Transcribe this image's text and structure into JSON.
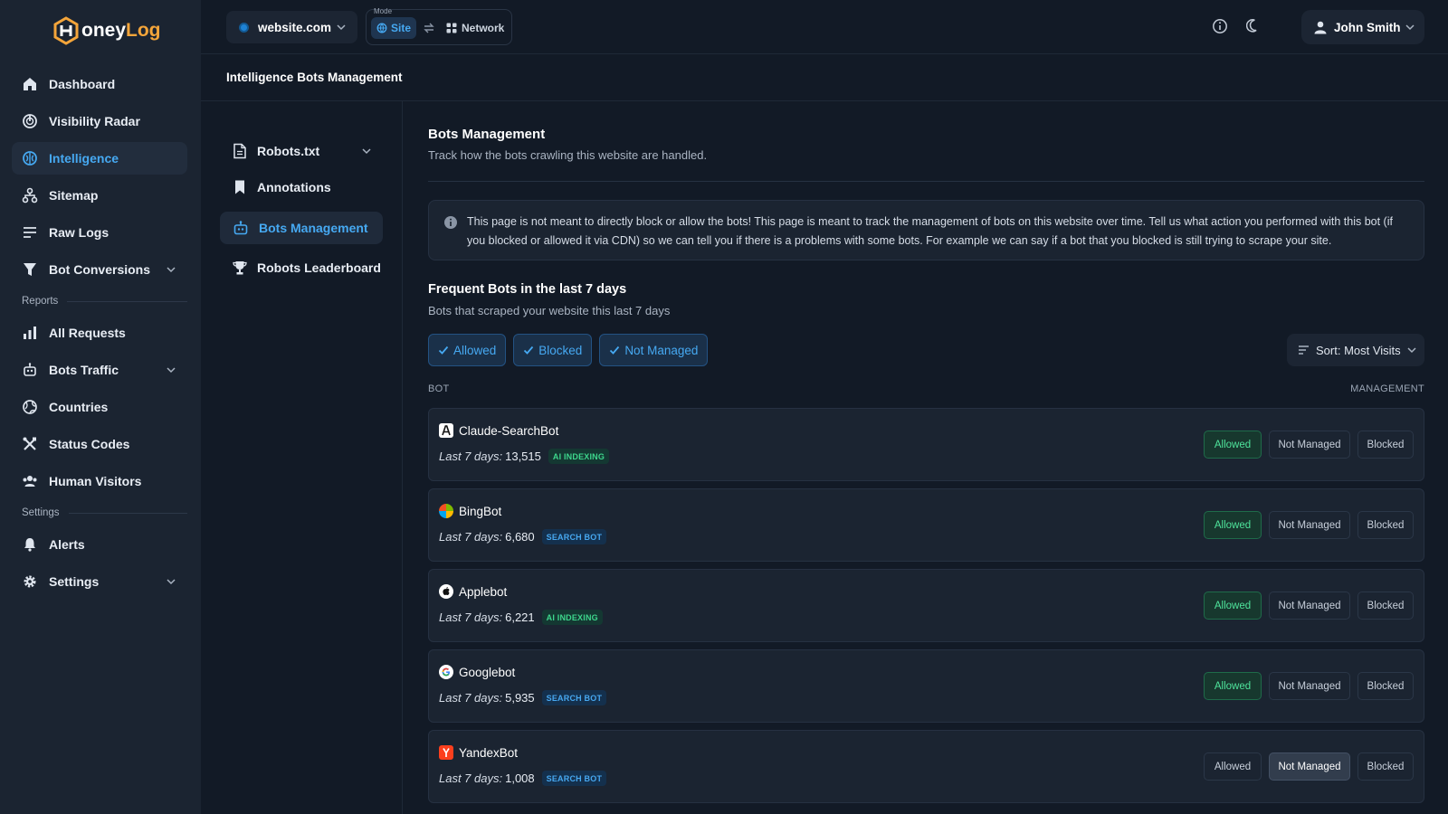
{
  "app": {
    "logo_pre": "H",
    "logo_mid": "oney",
    "logo_post": "Log"
  },
  "sidebar": {
    "items": [
      {
        "label": "Dashboard",
        "icon": "home-icon"
      },
      {
        "label": "Visibility Radar",
        "icon": "radar-icon"
      },
      {
        "label": "Intelligence",
        "icon": "brain-icon",
        "active": true
      },
      {
        "label": "Sitemap",
        "icon": "sitemap-icon"
      },
      {
        "label": "Raw Logs",
        "icon": "list-icon"
      },
      {
        "label": "Bot Conversions",
        "icon": "funnel-icon",
        "expandable": true
      }
    ],
    "reports_label": "Reports",
    "report_items": [
      {
        "label": "All Requests",
        "icon": "bar-chart-icon"
      },
      {
        "label": "Bots Traffic",
        "icon": "robot-icon",
        "expandable": true
      },
      {
        "label": "Countries",
        "icon": "globe-icon"
      },
      {
        "label": "Status Codes",
        "icon": "tools-icon"
      },
      {
        "label": "Human Visitors",
        "icon": "users-icon"
      }
    ],
    "settings_label": "Settings",
    "settings_items": [
      {
        "label": "Alerts",
        "icon": "bell-icon"
      },
      {
        "label": "Settings",
        "icon": "gear-icon",
        "expandable": true
      }
    ]
  },
  "topbar": {
    "site": "website.com",
    "mode_label": "Mode",
    "mode_site": "Site",
    "mode_network": "Network",
    "user": "John Smith"
  },
  "breadcrumb": {
    "part1": "Intelligence",
    "part2": "Bots Management"
  },
  "subnav": {
    "items": [
      {
        "label": "Robots.txt",
        "icon": "file-icon",
        "expandable": true
      },
      {
        "label": "Annotations",
        "icon": "bookmark-icon"
      },
      {
        "label": "Bots Management",
        "icon": "robot-icon",
        "active": true
      },
      {
        "label": "Robots Leaderboard",
        "icon": "trophy-icon"
      }
    ]
  },
  "main": {
    "title": "Bots Management",
    "subtitle": "Track how the bots crawling this website are handled.",
    "info": "This page is not meant to directly block or allow the bots! This page is meant to track the management of bots on this website over time. Tell us what action you performed with this bot (if you blocked or allowed it via CDN) so we can tell you if there is a problems with some bots. For example we can say if a bot that you blocked is still trying to scrape your site.",
    "section_title": "Frequent Bots in the last 7 days",
    "section_subtitle": "Bots that scraped your website this last 7 days",
    "filters": [
      "Allowed",
      "Blocked",
      "Not Managed"
    ],
    "sort_label": "Sort: Most Visits",
    "col_bot": "BOT",
    "col_management": "MANAGEMENT",
    "stat_label": "Last 7 days:",
    "actions": {
      "allowed": "Allowed",
      "not_managed": "Not Managed",
      "blocked": "Blocked"
    },
    "bots": [
      {
        "name": "Claude-SearchBot",
        "count": "13,515",
        "badge": "AI INDEXING",
        "badge_type": "ai",
        "logo": "claude-logo-icon",
        "status": "allowed"
      },
      {
        "name": "BingBot",
        "count": "6,680",
        "badge": "SEARCH BOT",
        "badge_type": "search",
        "logo": "microsoft-logo-icon",
        "status": "allowed"
      },
      {
        "name": "Applebot",
        "count": "6,221",
        "badge": "AI INDEXING",
        "badge_type": "ai",
        "logo": "apple-logo-icon",
        "status": "allowed"
      },
      {
        "name": "Googlebot",
        "count": "5,935",
        "badge": "SEARCH BOT",
        "badge_type": "search",
        "logo": "google-logo-icon",
        "status": "allowed"
      },
      {
        "name": "YandexBot",
        "count": "1,008",
        "badge": "SEARCH BOT",
        "badge_type": "search",
        "logo": "yandex-logo-icon",
        "status": "not_managed"
      }
    ]
  }
}
